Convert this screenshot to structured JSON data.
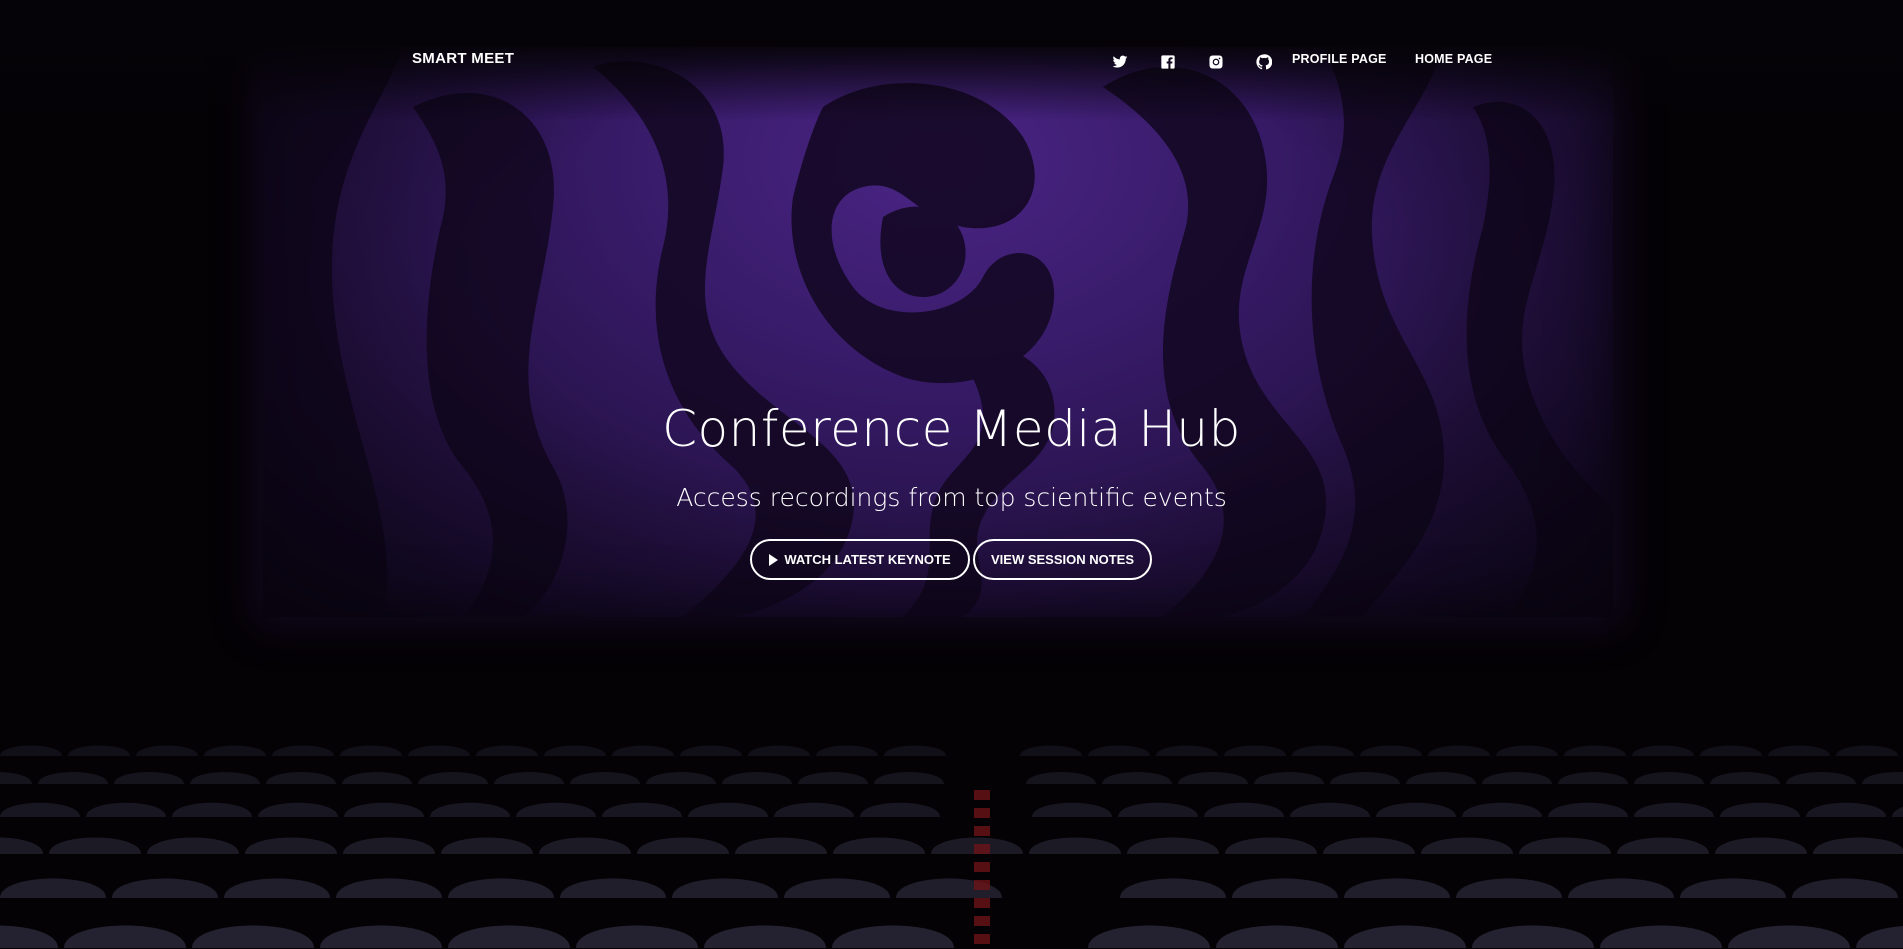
{
  "nav": {
    "brand": "SMART MEET",
    "icons": [
      "twitter-icon",
      "facebook-icon",
      "instagram-icon",
      "github-icon"
    ],
    "links": [
      "PROFILE PAGE",
      "HOME PAGE"
    ]
  },
  "hero": {
    "title": "Conference Media Hub",
    "subtitle": "Access recordings from top scientific events",
    "primary_button": "WATCH LATEST KEYNOTE",
    "secondary_button": "VIEW SESSION NOTES"
  },
  "colors": {
    "screen_purple": "#3a1c6e",
    "background": "#050307",
    "text": "#ffffff"
  }
}
